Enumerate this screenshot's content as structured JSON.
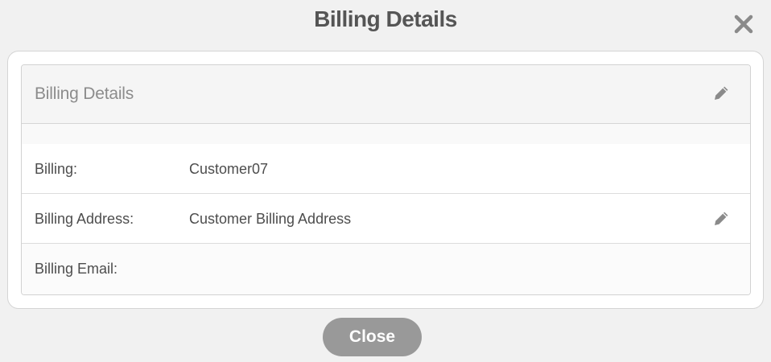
{
  "dialog": {
    "title": "Billing Details",
    "close_icon": "close-x-icon"
  },
  "panel": {
    "title": "Billing Details",
    "edit_icon": "pencil-icon",
    "rows": [
      {
        "label": "Billing:",
        "value": "Customer07",
        "editable": false
      },
      {
        "label": "Billing Address:",
        "value": "Customer Billing Address",
        "editable": true
      },
      {
        "label": "Billing Email:",
        "value": "",
        "editable": false
      }
    ]
  },
  "footer": {
    "close_label": "Close"
  },
  "colors": {
    "background": "#f1f1f1",
    "title": "#555555",
    "icon": "#8a8a8a",
    "close_button": "#999999"
  }
}
